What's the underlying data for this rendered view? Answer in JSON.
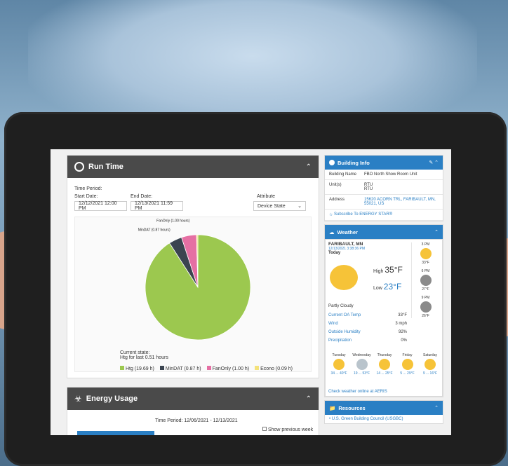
{
  "run_time": {
    "title": "Run Time",
    "time_period_label": "Time Period:",
    "start_label": "Start Date:",
    "end_label": "End Date:",
    "attribute_label": "Attribute",
    "start_value": "12/12/2021 12:00 PM",
    "end_value": "12/13/2021 11:59 PM",
    "attribute_value": "Device State",
    "current_state_label": "Current state:",
    "current_state_value": "Htg for last 0.51 hours"
  },
  "chart_data": {
    "type": "pie",
    "categories": [
      "Htg",
      "MinDAT",
      "FanOnly",
      "Econo"
    ],
    "values": [
      19.69,
      0.87,
      1.0,
      0.09
    ],
    "colors": [
      "#9cc84f",
      "#3b4450",
      "#e56fa3",
      "#f4e27a"
    ],
    "labels": [
      "Htg (19.69 h)",
      "MinDAT (0.87 hours)",
      "FanOnly (1.00 hours)",
      "Econo (0.09 hours)"
    ],
    "legend": [
      "Htg (19.69 h)",
      "MinDAT (0.87 h)",
      "FanOnly (1.00 h)",
      "Econo (0.09 h)"
    ]
  },
  "energy": {
    "title": "Energy Usage",
    "time_period": "Time Period: 12/06/2021 - 12/13/2021",
    "show_previous": "Show previous week"
  },
  "building_info": {
    "title": "Building Info",
    "rows": [
      {
        "k": "Building Name",
        "v": "FBO North Show Room Unit"
      },
      {
        "k": "Unit(s)",
        "v": "RTU\nRTU"
      },
      {
        "k": "Address",
        "v": "15620 ACORN TRL, FARIBAULT, MN, 55021, US"
      }
    ],
    "energy_star": "Subscribe To ENERGY STAR®"
  },
  "weather": {
    "title": "Weather",
    "location": "FARIBAULT, MN",
    "timestamp": "12/13/2021 3:38:36 PM",
    "today": "Today",
    "high_label": "High",
    "high": "35°F",
    "low_label": "Low",
    "low": "23°F",
    "condition": "Partly Cloudy",
    "current_oa_label": "Current OA Temp",
    "current_oa": "33°F",
    "wind_label": "Wind",
    "wind": "3 mph",
    "humidity_label": "Outside Humidity",
    "humidity": "92%",
    "precip_label": "Precipitation",
    "precip": "0%",
    "hourly": [
      {
        "time": "3 PM",
        "temp": "33°F"
      },
      {
        "time": "6 PM",
        "temp": "27°F"
      },
      {
        "time": "9 PM",
        "temp": "26°F"
      }
    ],
    "days": [
      {
        "d": "Tuesday",
        "t": "34 ... 40°F"
      },
      {
        "d": "Wednesday",
        "t": "19 ... 53°F"
      },
      {
        "d": "Thursday",
        "t": "14 ... 25°F"
      },
      {
        "d": "Friday",
        "t": "5 ... 29°F"
      },
      {
        "d": "Saturday",
        "t": "9 ... 16°F"
      }
    ],
    "aeris_link": "Check weather online at AERIS"
  },
  "resources": {
    "title": "Resources",
    "items": [
      "U.S. Green Building Council (USGBC)"
    ]
  }
}
